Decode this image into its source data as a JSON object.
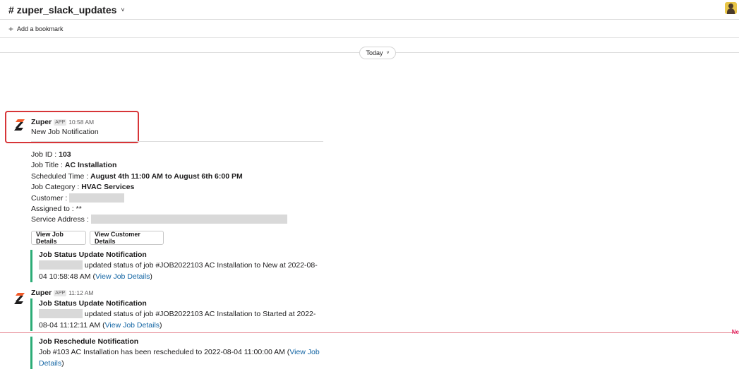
{
  "header": {
    "hash": "#",
    "channel_name": "zuper_slack_updates",
    "chevron": "˅"
  },
  "bookmark": {
    "plus": "+",
    "label": "Add a bookmark"
  },
  "divider": {
    "label": "Today",
    "chevron": "˅"
  },
  "message1": {
    "sender": "Zuper",
    "badge": "APP",
    "time": "10:58 AM",
    "text": "New Job Notification"
  },
  "job": {
    "id_label": "Job ID : ",
    "id_value": "103",
    "title_label": "Job Title : ",
    "title_value": "AC Installation",
    "scheduled_label": "Scheduled Time : ",
    "scheduled_value": "August 4th 11:00 AM to August 6th 6:00 PM",
    "category_label": "Job Category : ",
    "category_value": "HVAC Services",
    "customer_label": "Customer : ",
    "assigned_label": "Assigned to : ",
    "assigned_value": "**",
    "address_label": "Service Address : "
  },
  "buttons": {
    "view_job": "View Job Details",
    "view_customer": "View Customer Details"
  },
  "attach1": {
    "title": "Job Status Update Notification",
    "line1": "updated status of job #JOB2022103 AC Installation to New at 2022-08-",
    "line2_prefix": "04 10:58:48 AM (",
    "link": "View Job Details",
    "suffix": ")"
  },
  "message2": {
    "sender": "Zuper",
    "badge": "APP",
    "time": "11:12 AM"
  },
  "attach2": {
    "title": "Job Status Update Notification",
    "line1": "updated status of job #JOB2022103 AC Installation to Started at 2022-",
    "line2_prefix": "08-04 11:12:11 AM (",
    "link": "View Job Details",
    "suffix": ")"
  },
  "new_marker": "Ne",
  "attach3": {
    "title": "Job Reschedule Notification",
    "line1_prefix": "Job #103 AC Installation has been rescheduled to 2022-08-04 11:00:00 AM (",
    "link_part1": "View Job",
    "link_part2": "Details",
    "suffix": ")"
  },
  "colors": {
    "accent_green": "#2bac76",
    "link_blue": "#1264a3",
    "highlight_red": "#d73538",
    "zuper_orange": "#f15a29"
  }
}
